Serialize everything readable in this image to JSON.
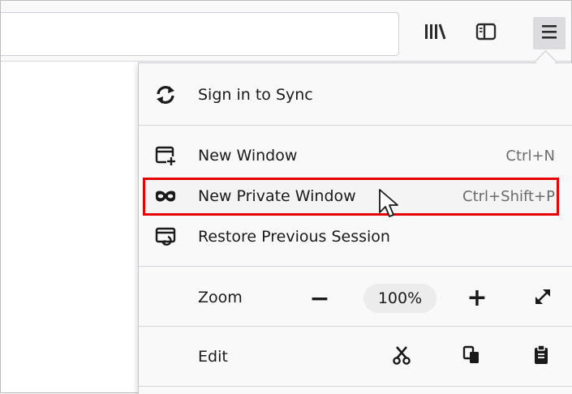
{
  "menu": {
    "sign_in": "Sign in to Sync",
    "new_window": "New Window",
    "new_window_shortcut": "Ctrl+N",
    "new_private_window": "New Private Window",
    "new_private_window_shortcut": "Ctrl+Shift+P",
    "restore_session": "Restore Previous Session",
    "zoom_label": "Zoom",
    "zoom_out": "−",
    "zoom_value": "100%",
    "zoom_in": "+",
    "edit_label": "Edit"
  },
  "colors": {
    "highlight": "#e60000",
    "menu_bg": "#f9f9fa",
    "page_bg": "#ffffff"
  },
  "icons": {
    "toolbar": [
      "library-icon",
      "sidebar-icon",
      "hamburger-menu-icon"
    ],
    "menu": [
      "sync-icon",
      "new-window-icon",
      "private-mask-icon",
      "restore-session-icon",
      "fullscreen-icon",
      "cut-icon",
      "copy-icon",
      "paste-icon"
    ]
  }
}
